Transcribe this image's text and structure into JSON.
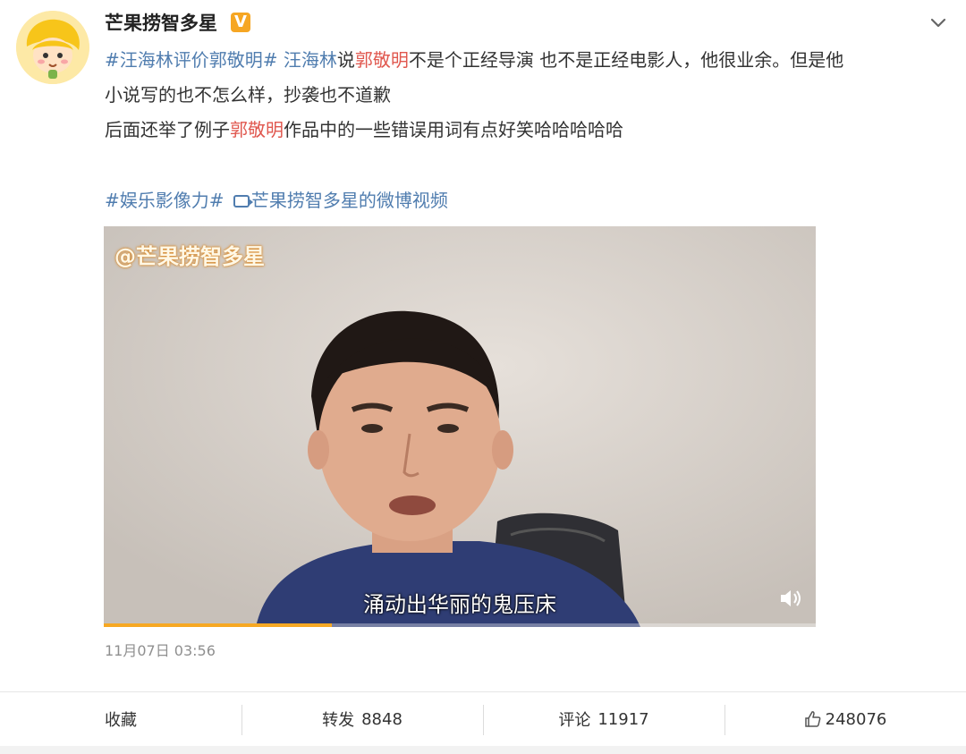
{
  "post": {
    "username": "芒果捞智多星",
    "verified_badge": "V",
    "body": {
      "line1": [
        {
          "t": "#汪海林评价郭敬明#",
          "kind": "link"
        },
        {
          "t": " ",
          "kind": "text"
        },
        {
          "t": "汪海林",
          "kind": "link"
        },
        {
          "t": "说",
          "kind": "text"
        },
        {
          "t": "郭敬明",
          "kind": "mention"
        },
        {
          "t": "不是个正经导演 也不是正经电影人，他很业余。但是他",
          "kind": "text"
        }
      ],
      "line2": "小说写的也不怎么样，抄袭也不道歉",
      "line3_pre": "后面还举了例子",
      "line3_mention": "郭敬明",
      "line3_post": "作品中的一些错误用词有点好笑哈哈哈哈哈"
    },
    "topic_tag": "#娱乐影像力#",
    "video_source_label": "芒果捞智多星的微博视频",
    "video": {
      "watermark": "@芒果捞智多星",
      "subtitle": "涌动出华丽的鬼压床",
      "progress_fraction": 0.32
    },
    "timestamp": "11月07日 03:56"
  },
  "footer": {
    "favorite_label": "收藏",
    "repost_label": "转发",
    "repost_count": "8848",
    "comment_label": "评论",
    "comment_count": "11917",
    "like_count": "248076"
  },
  "colors": {
    "link": "#507daf",
    "mention": "#e0574e",
    "badge": "#f6a623",
    "progress": "#f7a823"
  }
}
